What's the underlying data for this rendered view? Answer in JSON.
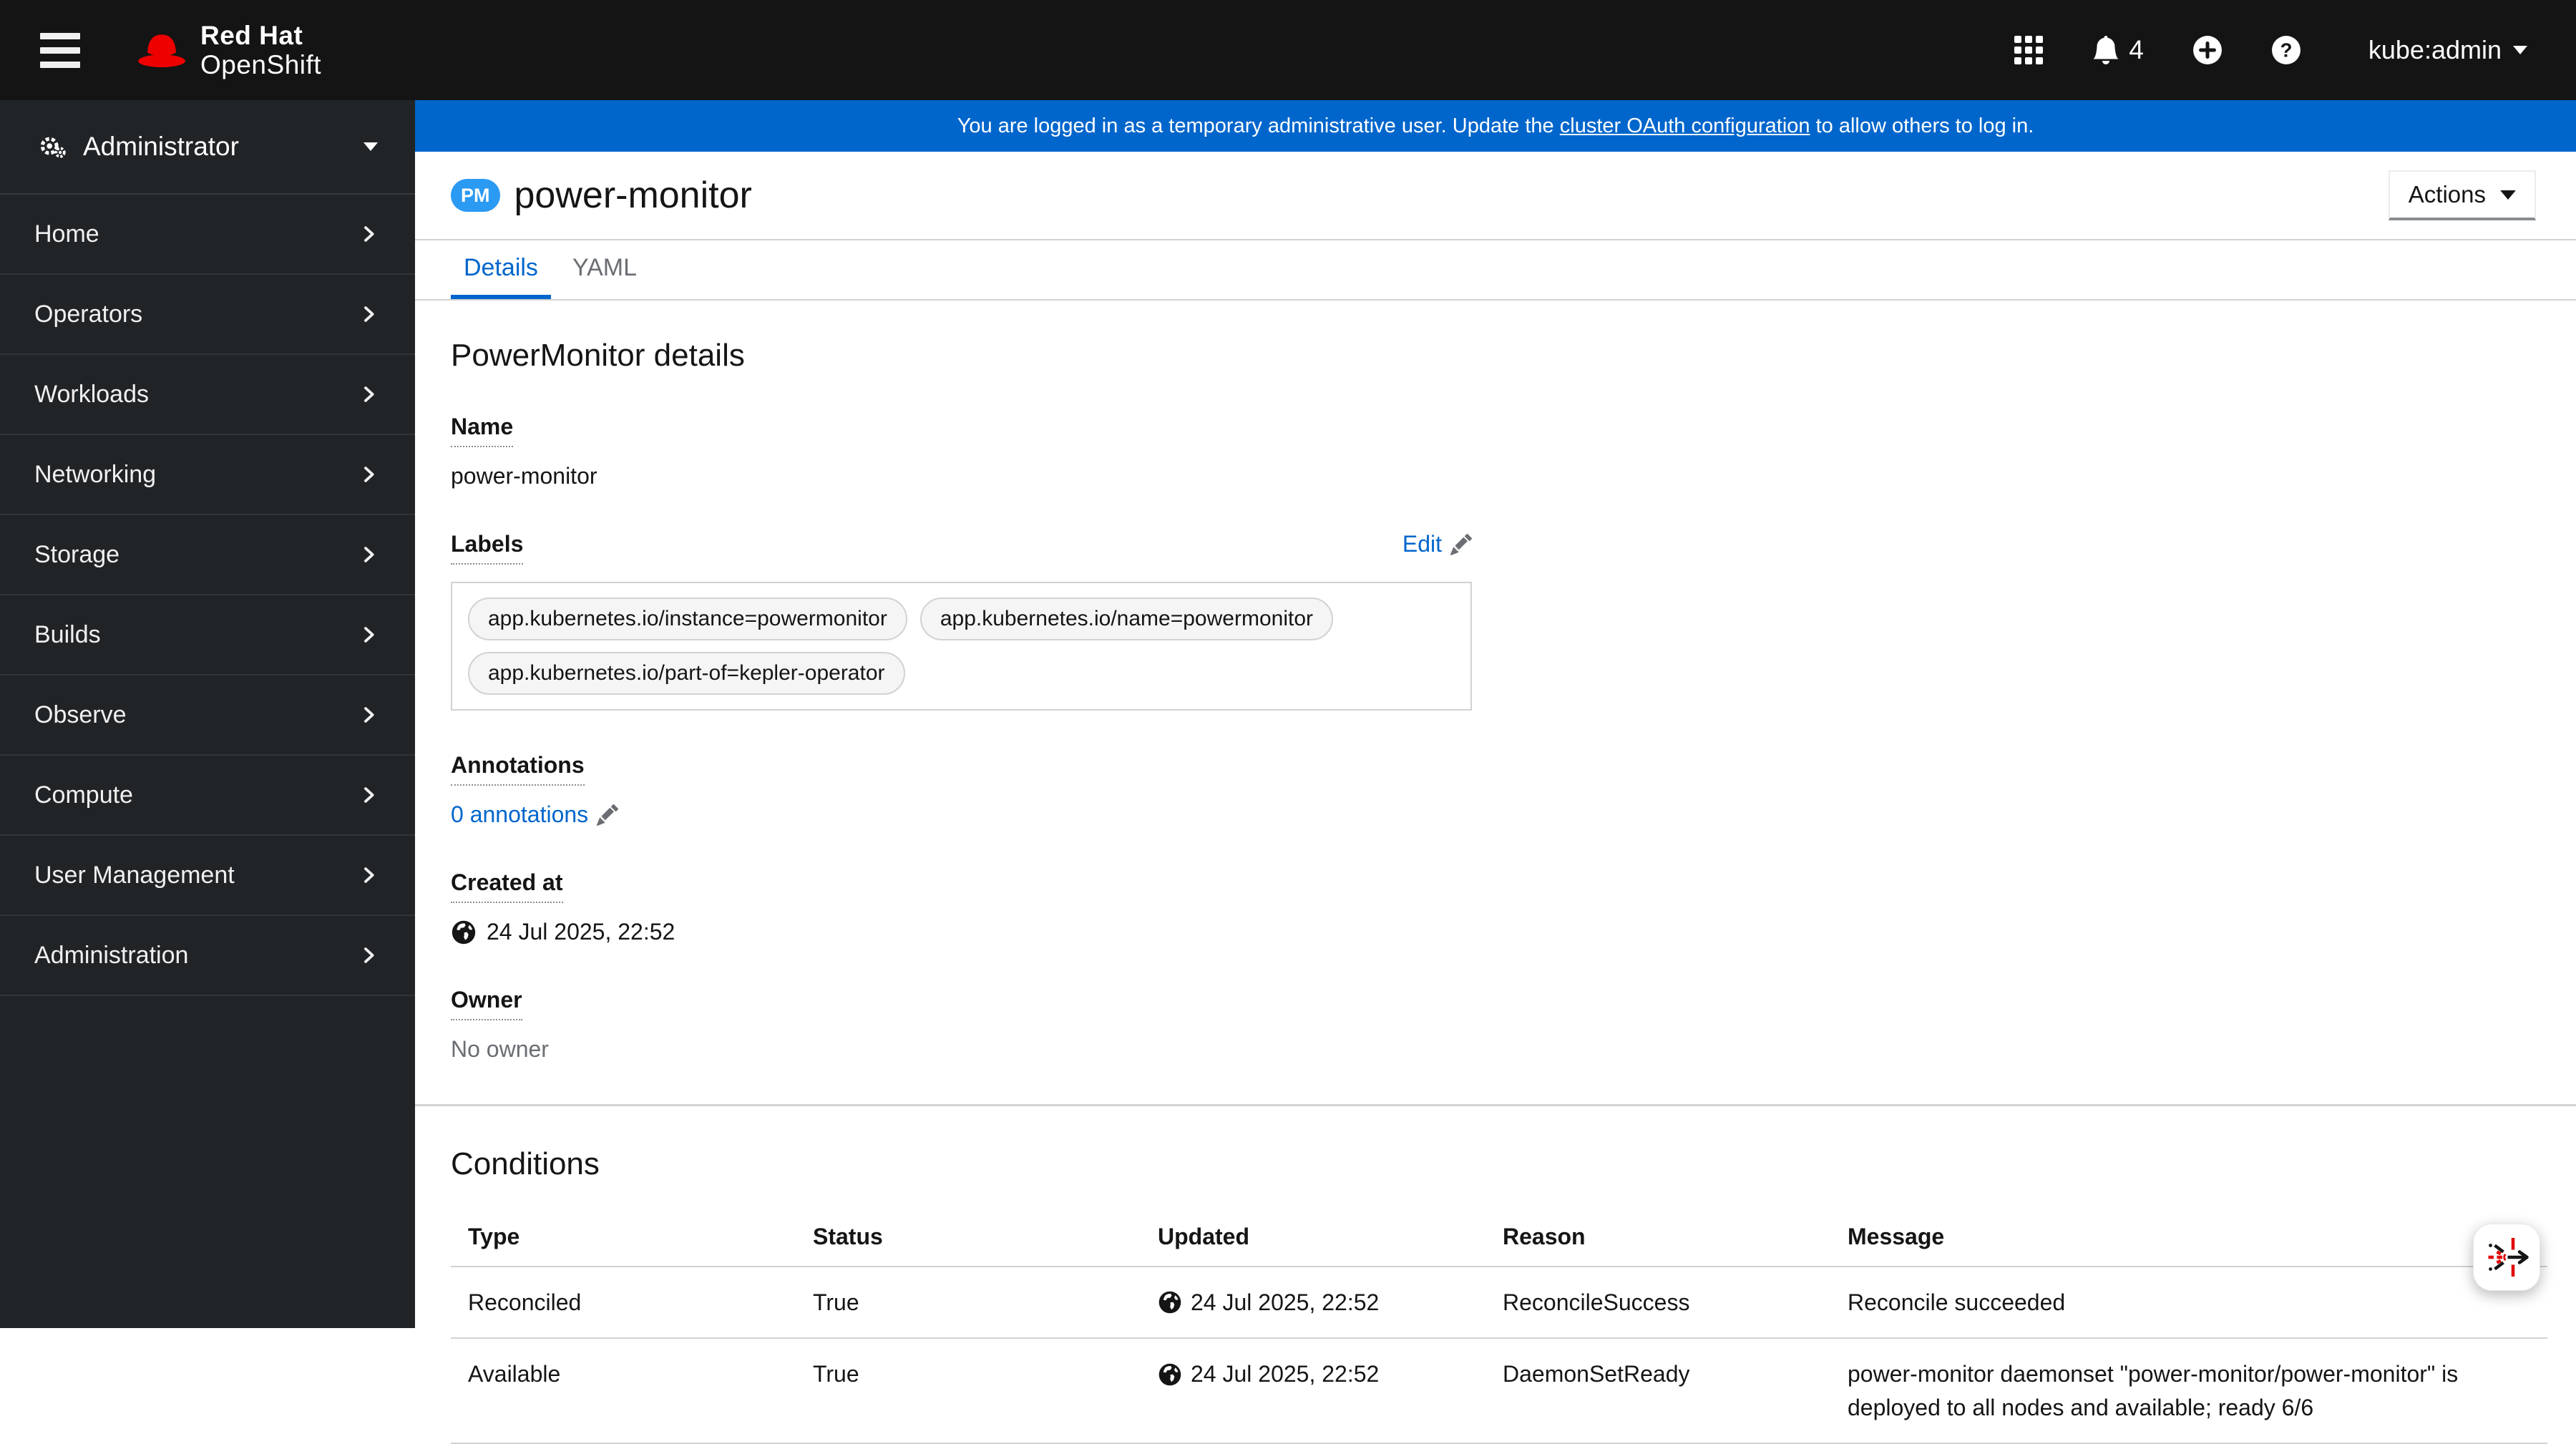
{
  "masthead": {
    "brand_top": "Red Hat",
    "brand_bottom": "OpenShift",
    "notification_count": "4",
    "user_menu": "kube:admin"
  },
  "banner": {
    "text_before": "You are logged in as a temporary administrative user. Update the ",
    "link_text": "cluster OAuth configuration",
    "text_after": " to allow others to log in."
  },
  "sidebar": {
    "perspective": "Administrator",
    "items": [
      "Home",
      "Operators",
      "Workloads",
      "Networking",
      "Storage",
      "Builds",
      "Observe",
      "Compute",
      "User Management",
      "Administration"
    ]
  },
  "page": {
    "badge": "PM",
    "title": "power-monitor",
    "actions_label": "Actions",
    "tab_details": "Details",
    "tab_yaml": "YAML"
  },
  "details": {
    "heading": "PowerMonitor details",
    "name_label": "Name",
    "name_value": "power-monitor",
    "labels_label": "Labels",
    "edit_label": "Edit",
    "labels": [
      "app.kubernetes.io/instance=powermonitor",
      "app.kubernetes.io/name=powermonitor",
      "app.kubernetes.io/part-of=kepler-operator"
    ],
    "annotations_label": "Annotations",
    "annotations_value": "0 annotations",
    "created_label": "Created at",
    "created_value": "24 Jul 2025, 22:52",
    "owner_label": "Owner",
    "owner_value": "No owner"
  },
  "conditions": {
    "heading": "Conditions",
    "columns": [
      "Type",
      "Status",
      "Updated",
      "Reason",
      "Message"
    ],
    "rows": [
      {
        "type": "Reconciled",
        "status": "True",
        "updated": "24 Jul 2025, 22:52",
        "reason": "ReconcileSuccess",
        "message": "Reconcile succeeded"
      },
      {
        "type": "Available",
        "status": "True",
        "updated": "24 Jul 2025, 22:52",
        "reason": "DaemonSetReady",
        "message": "power-monitor daemonset \"power-monitor/power-monitor\" is deployed to all nodes and available; ready 6/6"
      }
    ]
  },
  "colors": {
    "masthead_black": "#141414",
    "sidebar_dark": "#212427",
    "banner_blue": "#0066cc",
    "link_blue": "#0066cc",
    "badge_blue": "#2b9af3",
    "brand_red": "#ee0000",
    "border_gray": "#d2d2d2",
    "muted_gray": "#6a6e73"
  }
}
